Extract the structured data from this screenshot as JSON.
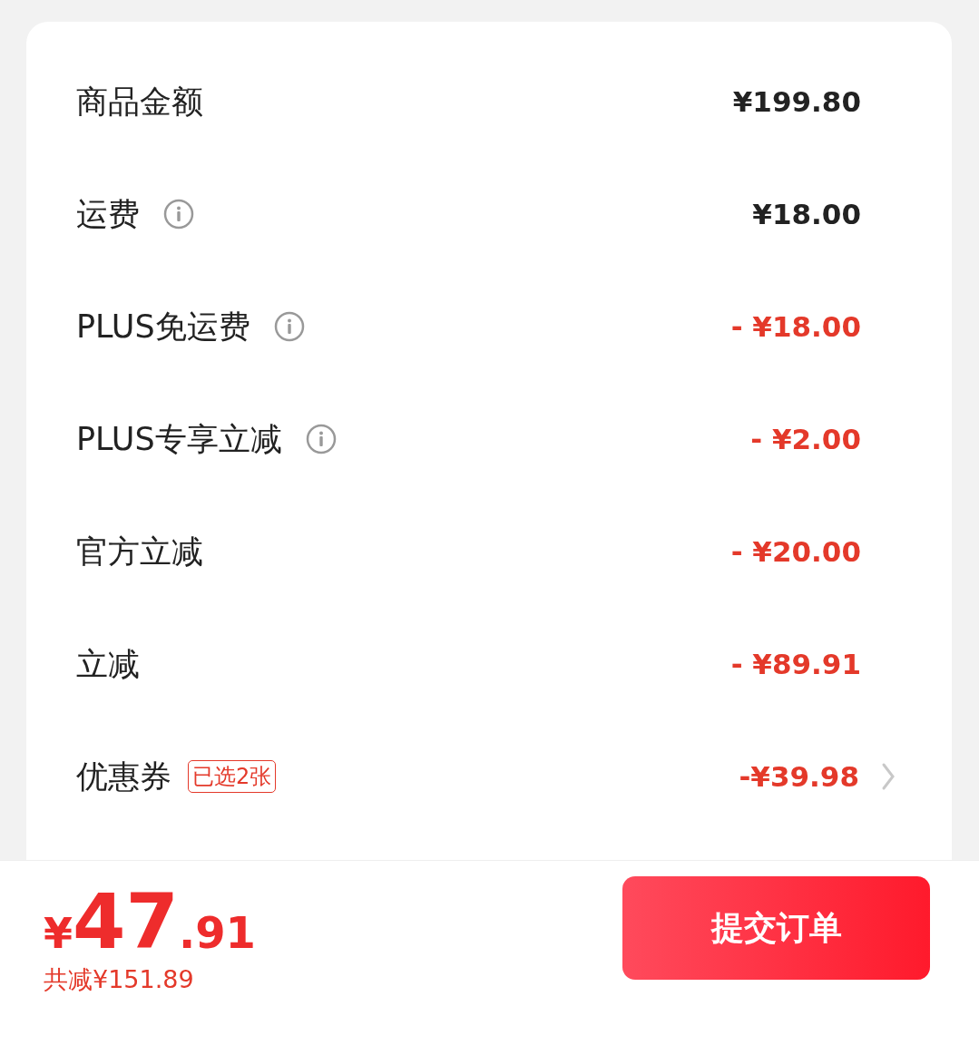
{
  "summary_rows": [
    {
      "label": "商品金额",
      "info": false,
      "amount": "¥199.80",
      "discount": false,
      "chevron": false
    },
    {
      "label": "运费",
      "info": true,
      "amount": "¥18.00",
      "discount": false,
      "chevron": false
    },
    {
      "label": "PLUS免运费",
      "info": true,
      "amount": "- ¥18.00",
      "discount": true,
      "chevron": false
    },
    {
      "label": "PLUS专享立减",
      "info": true,
      "amount": "- ¥2.00",
      "discount": true,
      "chevron": false
    },
    {
      "label": "官方立减",
      "info": false,
      "amount": "- ¥20.00",
      "discount": true,
      "chevron": false
    },
    {
      "label": "立减",
      "info": false,
      "amount": "- ¥89.91",
      "discount": true,
      "chevron": false
    },
    {
      "label": "优惠券",
      "info": false,
      "tag": "已选2张",
      "amount": "-¥39.98",
      "discount": true,
      "chevron": true
    }
  ],
  "footer": {
    "currency": "¥",
    "price_integer": "47",
    "price_decimal": ".91",
    "total_saved": "共减¥151.89",
    "submit_button": "提交订单"
  }
}
